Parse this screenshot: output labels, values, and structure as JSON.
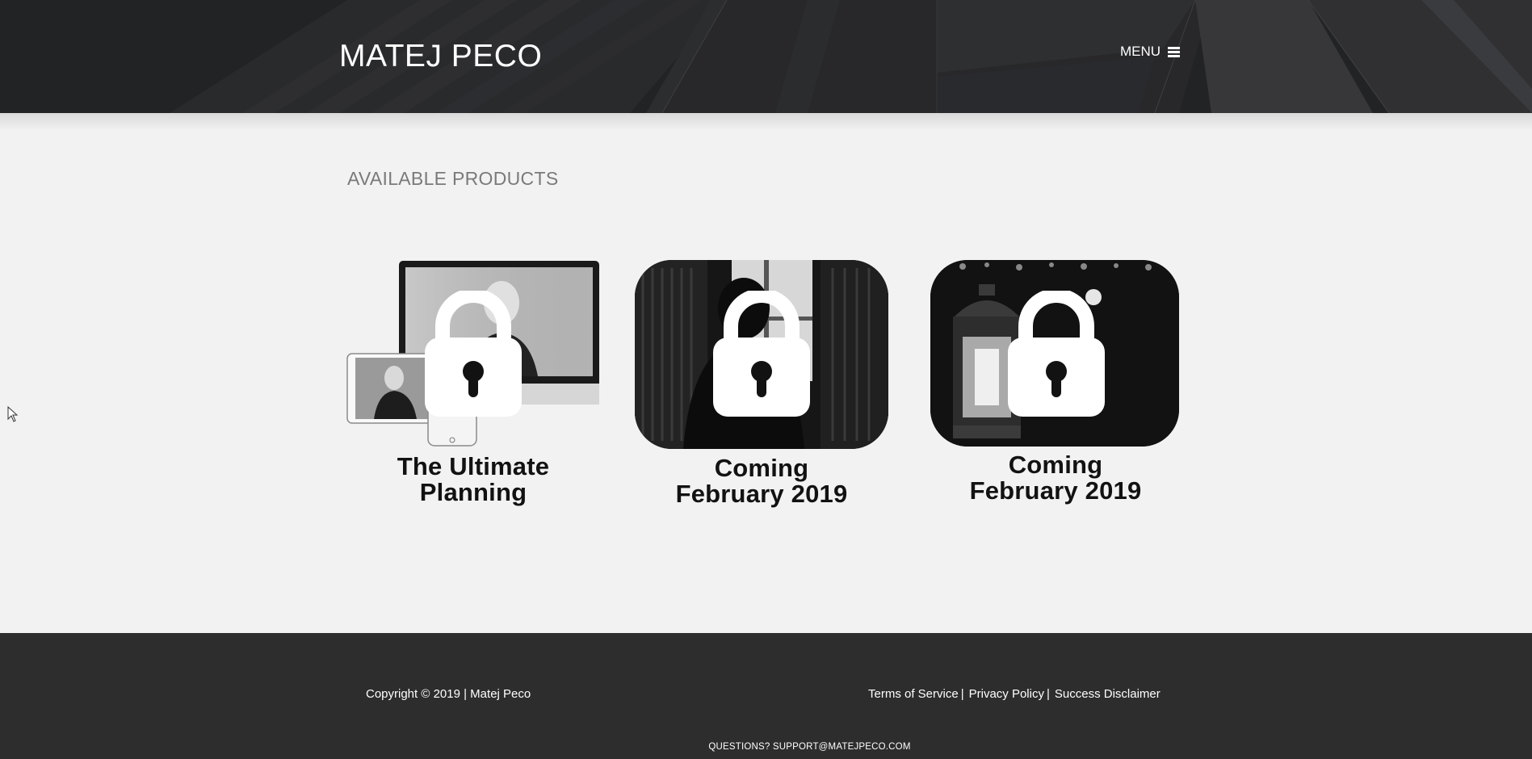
{
  "header": {
    "brand": "MATEJ PECO",
    "menu_label": "MENU",
    "menu_icon": "hamburger-icon"
  },
  "main": {
    "section_title": "AVAILABLE PRODUCTS",
    "products": [
      {
        "title_line1": "The Ultimate",
        "title_line2": "Planning",
        "locked_icon": "lock-icon"
      },
      {
        "title_line1": "Coming",
        "title_line2": "February 2019",
        "locked_icon": "lock-icon"
      },
      {
        "title_line1": "Coming",
        "title_line2": "February 2019",
        "locked_icon": "lock-icon"
      }
    ]
  },
  "footer": {
    "copyright": "Copyright © 2019 | Matej Peco",
    "links": [
      "Terms of Service",
      "Privacy Policy",
      "Success Disclaimer"
    ],
    "separator": "|",
    "questions": "QUESTIONS? SUPPORT@MATEJPECO.COM"
  },
  "colors": {
    "header_bg": "#2b2c2e",
    "page_bg": "#f2f2f2",
    "footer_bg": "#2d2d2d",
    "section_title": "#7a7a7a",
    "product_title": "#121212"
  }
}
